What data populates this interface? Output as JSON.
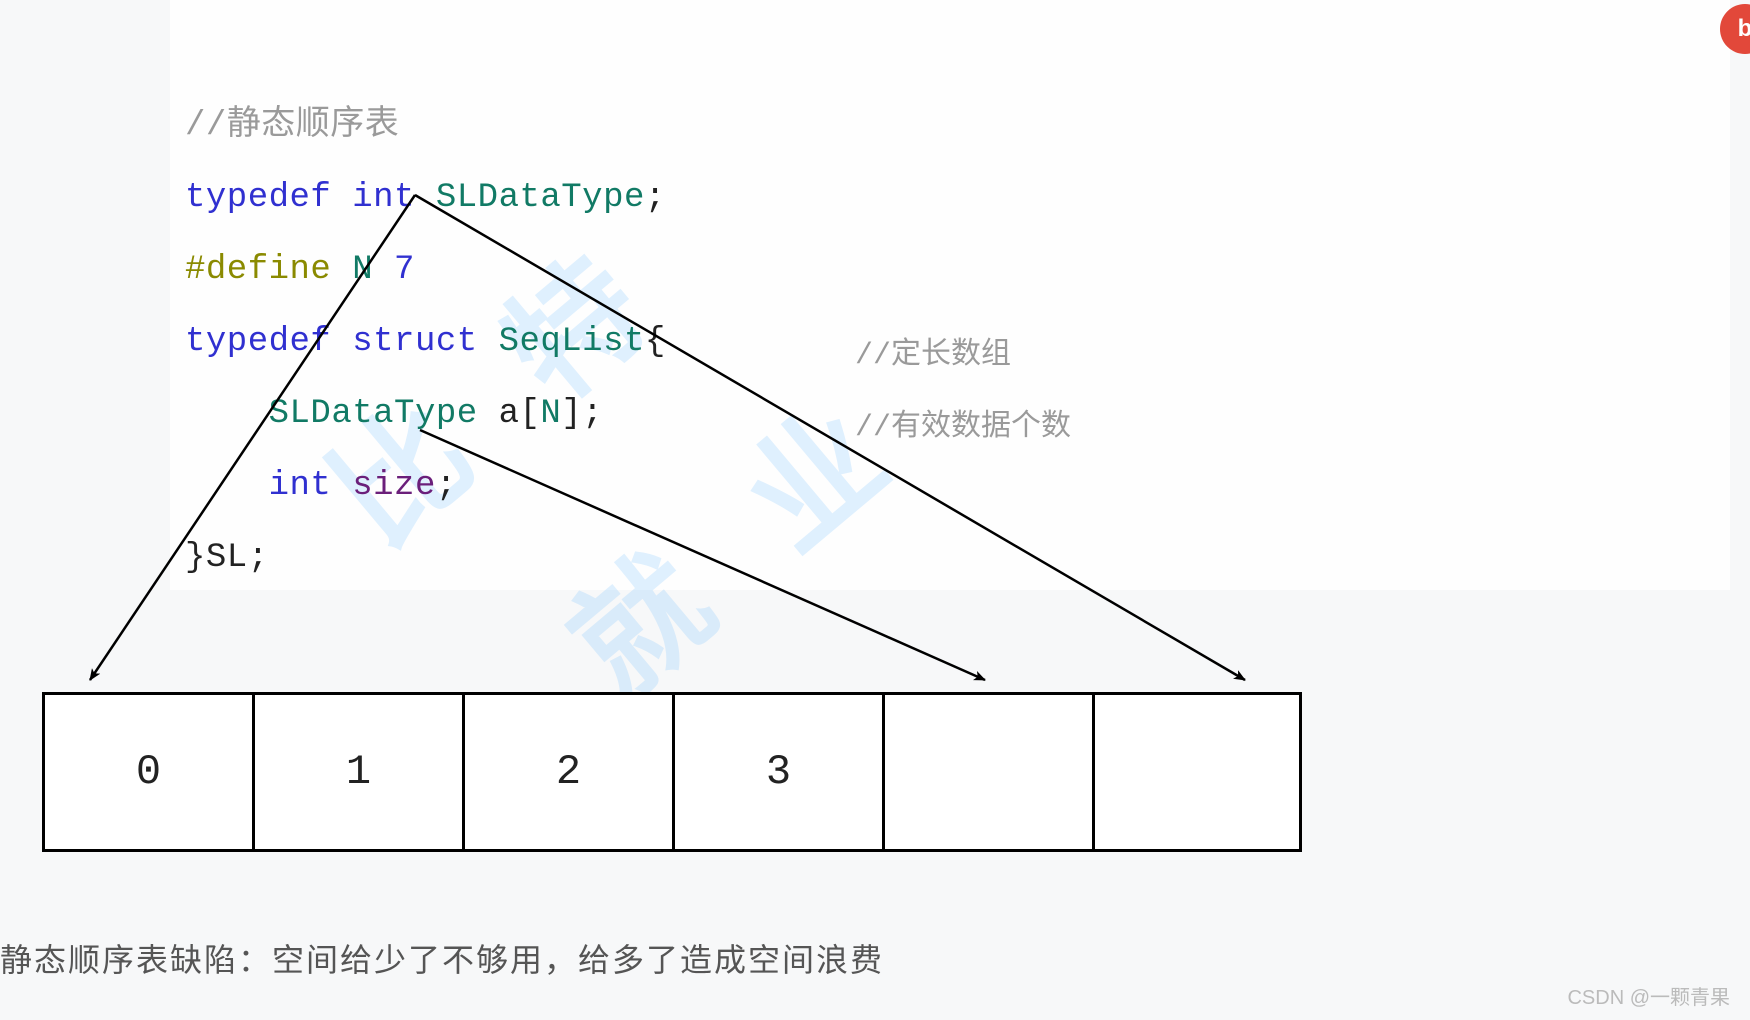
{
  "code": {
    "comment_top": "//静态顺序表",
    "line2_typedef": "typedef",
    "line2_int": "int",
    "line2_type": "SLDataType",
    "line2_semi": ";",
    "line3_define": "#define",
    "line3_N": "N",
    "line3_val": "7",
    "line4_typedef": "typedef",
    "line4_struct": "struct",
    "line4_name": "SeqList",
    "line4_brace": "{",
    "line5_indent": "    ",
    "line5_type": "SLDataType",
    "line5_arr": " a[",
    "line5_N": "N",
    "line5_close": "];",
    "line5_comment": "//定长数组",
    "line6_indent": "    ",
    "line6_int": "int",
    "line6_size": " size",
    "line6_semi": ";",
    "line6_comment": "//有效数据个数",
    "line7_close": "}SL;"
  },
  "array": {
    "cells": [
      "0",
      "1",
      "2",
      "3",
      "",
      ""
    ]
  },
  "caption": "静态顺序表缺陷：空间给少了不够用，给多了造成空间浪费",
  "attribution": "CSDN @一颗青果",
  "watermark": {
    "line1": "比 特",
    "line2": "就 业"
  },
  "badge": "b"
}
